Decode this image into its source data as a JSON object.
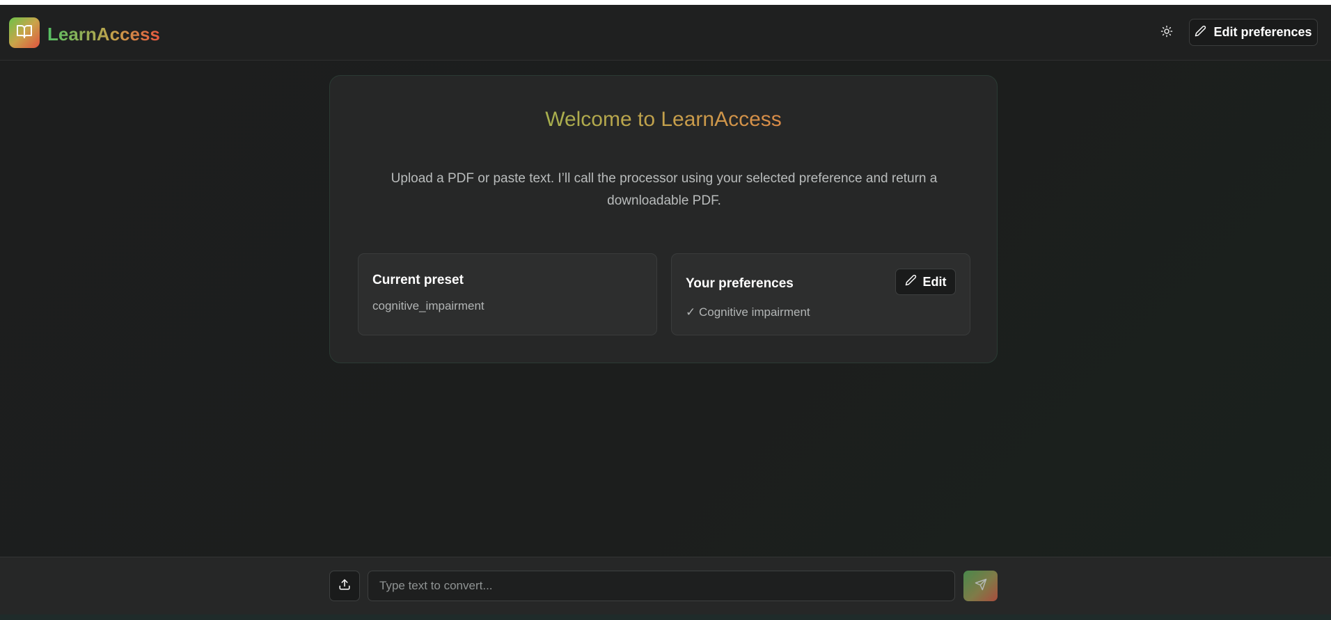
{
  "app": {
    "name": "LearnAccess"
  },
  "header": {
    "theme_toggle_icon": "sun-icon",
    "edit_preferences_label": "Edit preferences"
  },
  "welcome": {
    "title": "Welcome to LearnAccess",
    "subtitle": "Upload a PDF or paste text. I’ll call the processor using your selected preference and return a downloadable PDF."
  },
  "preset_card": {
    "heading": "Current preset",
    "value": "cognitive_impairment"
  },
  "preferences_card": {
    "heading": "Your preferences",
    "edit_label": "Edit",
    "items": [
      "✓ Cognitive impairment"
    ]
  },
  "composer": {
    "placeholder": "Type text to convert...",
    "value": "",
    "upload_icon": "upload-icon",
    "send_icon": "send-icon"
  },
  "colors": {
    "brand_gradient": [
      "#55c064",
      "#c7a04a",
      "#e4573f"
    ],
    "background": "#1d1e1e",
    "card": "#262727"
  }
}
